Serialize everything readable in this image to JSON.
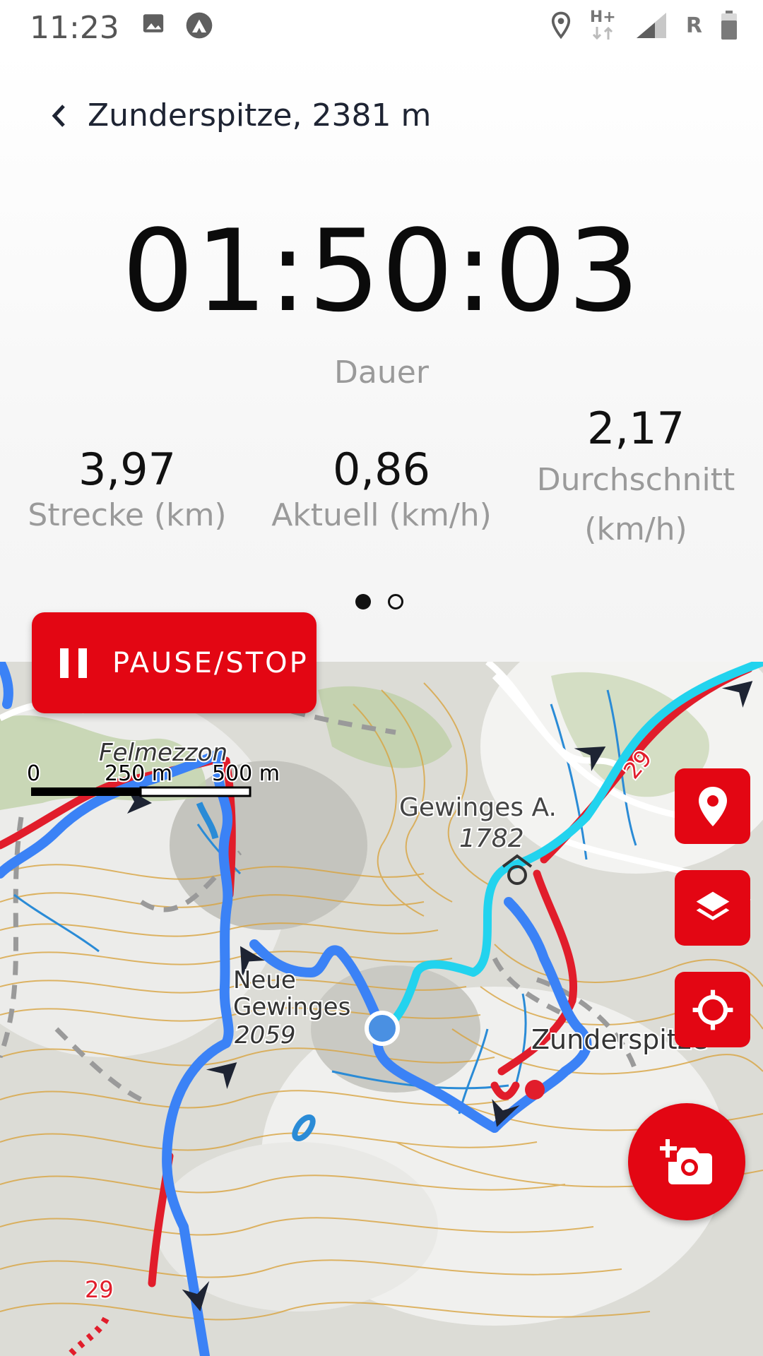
{
  "status_bar": {
    "time": "11:23",
    "icons": [
      "image-icon",
      "mountain-notification-icon",
      "location-icon",
      "network-hplus-icon",
      "signal-icon",
      "battery-icon"
    ],
    "network_type": "H+",
    "roaming": "R"
  },
  "header": {
    "title": "Zunderspitze, 2381 m"
  },
  "timer": {
    "value": "01:50:03",
    "label": "Dauer"
  },
  "stats": {
    "distance": {
      "value": "3,97",
      "label": "Strecke (km)"
    },
    "current_speed": {
      "value": "0,86",
      "label": "Aktuell (km/h)"
    },
    "average_speed": {
      "value": "2,17",
      "label_line1": "Durchschnitt",
      "label_line2": "(km/h)"
    }
  },
  "pager": {
    "pages": 2,
    "active_page": 1
  },
  "pause_button": {
    "label": "PAUSE/STOP"
  },
  "map": {
    "scale": {
      "zero": "0",
      "mid": "250 m",
      "end": "500 m"
    },
    "labels": {
      "village": "Felmezzon",
      "hut_name": "Gewinges A.",
      "hut_elevation": "1782",
      "peak_name_line1": "Neue",
      "peak_name_line2": "Gewinges",
      "peak_elevation": "2059",
      "summit": "Zunderspitze",
      "trail_number": "29"
    },
    "colors": {
      "track": "#3b82f6",
      "recorded": "#22d3ee",
      "trail": "#e11d2b",
      "contour": "#d9a441",
      "water": "#2a8bd6",
      "accent": "#e30613"
    }
  },
  "map_controls": {
    "icons": [
      "map-pin-icon",
      "layers-icon",
      "crosshair-icon",
      "add-photo-icon"
    ]
  }
}
